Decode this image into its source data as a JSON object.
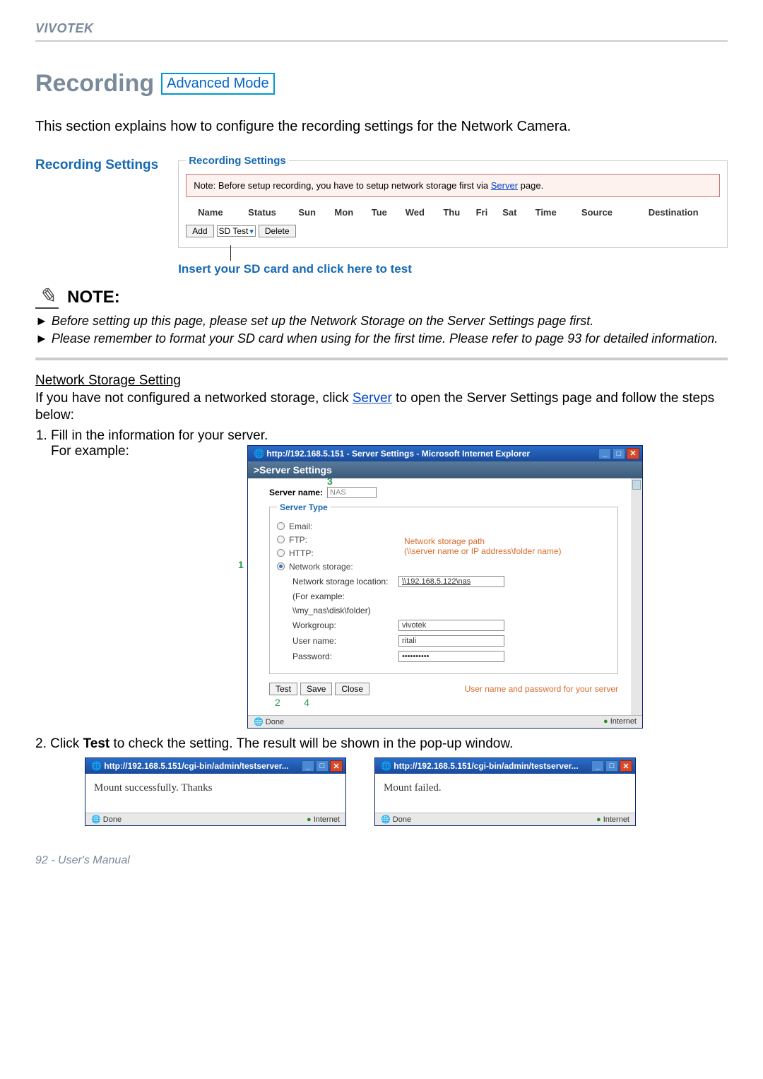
{
  "brand": "VIVOTEK",
  "title": "Recording",
  "adv_mode": "Advanced Mode",
  "intro": "This section explains how to configure the recording settings for the Network Camera.",
  "rec_settings_label": "Recording Settings",
  "rec_fieldset_legend": "Recording Settings",
  "rec_note_prefix": "Note: Before setup recording, you have to setup network storage first via ",
  "rec_note_link": "Server",
  "rec_note_suffix": " page.",
  "rec_table_headers": [
    "Name",
    "Status",
    "Sun",
    "Mon",
    "Tue",
    "Wed",
    "Thu",
    "Fri",
    "Sat",
    "Time",
    "Source",
    "Destination"
  ],
  "btn_add": "Add",
  "sel_sdtest": "SD Test",
  "btn_delete": "Delete",
  "insert_text": "Insert your SD card and click here to test",
  "note_title": "NOTE:",
  "note_items": [
    "► Before setting up this page, please set up the Network Storage on the Server Settings page first.",
    "► Please remember to format your SD card when using for the first time. Please refer to page 93 for detailed information."
  ],
  "nss_title": "Network Storage Setting",
  "nss_para_1a": "If you have not configured a networked storage, click ",
  "nss_para_1link": "Server",
  "nss_para_1b": " to open the Server Settings page and follow the steps below:",
  "step1": "Fill in the information for your server.",
  "for_example": "For example:",
  "ie_title": "http://192.168.5.151 - Server Settings - Microsoft Internet Explorer",
  "panel_head": ">Server Settings",
  "srv_name_label": "Server name:",
  "srv_name_value": "NAS",
  "callouts": {
    "c1": "1",
    "c3": "3",
    "c2": "2",
    "c4": "4"
  },
  "type_legend": "Server Type",
  "radio_email": "Email:",
  "radio_ftp": "FTP:",
  "radio_http": "HTTP:",
  "radio_ns": "Network storage:",
  "ns_annot_l1": "Network storage path",
  "ns_annot_l2": "(\\\\server name or IP address\\folder name)",
  "ns_loc_label": "Network storage location:",
  "ns_loc_value": "\\\\192.168.5.122\\nas",
  "ns_eg1": "(For example:",
  "ns_eg2": "\\\\my_nas\\disk\\folder)",
  "ns_wg_label": "Workgroup:",
  "ns_wg_value": "vivotek",
  "ns_user_label": "User name:",
  "ns_user_value": "ritali",
  "ns_pw_label": "Password:",
  "ns_pw_value": "••••••••••",
  "btn_test": "Test",
  "btn_save": "Save",
  "btn_close": "Close",
  "orange_annot": "User name and password for your server",
  "ie_done": "Done",
  "ie_internet": "Internet",
  "step2_a": "Click ",
  "step2_b": "Test",
  "step2_c": " to check the setting. The result will be shown in the pop-up window.",
  "popup_title": "http://192.168.5.151/cgi-bin/admin/testserver...",
  "popup1_msg": "Mount successfully. Thanks",
  "popup2_msg": "Mount failed.",
  "footer": "92 - User's Manual"
}
